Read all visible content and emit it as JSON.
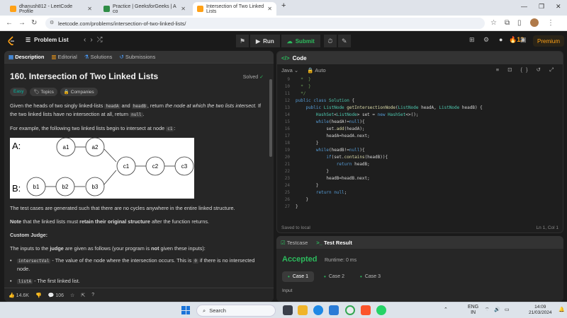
{
  "browser": {
    "tabs": [
      {
        "title": "dhanush812 - LeetCode Profile",
        "color": "#ffa116",
        "active": false
      },
      {
        "title": "Practice | GeeksforGeeks | A co",
        "color": "#2f8d46",
        "active": false
      },
      {
        "title": "Intersection of Two Linked Lists",
        "color": "#ffa116",
        "active": true
      }
    ],
    "url": "leetcode.com/problems/intersection-of-two-linked-lists/"
  },
  "nav": {
    "problem_list": "Problem List",
    "run": "Run",
    "submit": "Submit",
    "streak": "13",
    "premium": "Premium"
  },
  "left": {
    "tabs": [
      "Description",
      "Editorial",
      "Solutions",
      "Submissions"
    ],
    "title": "160. Intersection of Two Linked Lists",
    "solved": "Solved",
    "tags": [
      "Easy",
      "Topics",
      "Companies"
    ],
    "desc_1": "Given the heads of two singly linked-lists",
    "headA": "headA",
    "and": "and",
    "headB": "headB",
    "desc_2": ", return",
    "desc_3": "the node at which the two lists intersect.",
    "desc_4": "If the two linked lists have no intersection at all, return",
    "null": "null",
    "example_intro": "For example, the following two linked lists begin to intersect at node",
    "c1": "c1",
    "diagram": {
      "labelA": "A:",
      "labelB": "B:",
      "nodes": [
        "a1",
        "a2",
        "c1",
        "c2",
        "c3",
        "b1",
        "b2",
        "b3"
      ]
    },
    "p_cycles": "The test cases are generated such that there are no cycles anywhere in the entire linked structure.",
    "note_label": "Note",
    "note_mid": "that the linked lists must",
    "note_bold": "retain their original structure",
    "note_end": "after the function returns.",
    "judge_heading": "Custom Judge:",
    "judge_intro_1": "The inputs to the",
    "judge_word": "judge",
    "judge_intro_2": "are given as follows (your program is",
    "not_word": "not",
    "judge_intro_3": "given these inputs):",
    "b1_code": "intersectVal",
    "b1_text": "- The value of the node where the intersection occurs. This is",
    "b1_zero": "0",
    "b1_end": "if there is no intersected node.",
    "b2_code": "listA",
    "b2_text": "- The first linked list.",
    "likes": "14.6K",
    "comments": "106"
  },
  "code": {
    "header": "Code",
    "lang": "Java",
    "auto": "Auto",
    "lines": [
      {
        "n": "9",
        "t": "  *  }"
      },
      {
        "n": "10",
        "t": "  *  }"
      },
      {
        "n": "11",
        "t": "  */"
      },
      {
        "n": "12",
        "t": "public class Solution {"
      },
      {
        "n": "13",
        "t": "    public ListNode getIntersectionNode(ListNode headA, ListNode headB) {"
      },
      {
        "n": "14",
        "t": "        HashSet<ListNode> set = new HashSet<>();"
      },
      {
        "n": "15",
        "t": "        while(headA!=null){"
      },
      {
        "n": "16",
        "t": "            set.add(headA);"
      },
      {
        "n": "17",
        "t": "            headA=headA.next;"
      },
      {
        "n": "18",
        "t": "        }"
      },
      {
        "n": "19",
        "t": "        while(headB!=null){"
      },
      {
        "n": "20",
        "t": "            if(set.contains(headB)){"
      },
      {
        "n": "21",
        "t": "                return headB;"
      },
      {
        "n": "22",
        "t": "            }"
      },
      {
        "n": "23",
        "t": "            headB=headB.next;"
      },
      {
        "n": "24",
        "t": "        }"
      },
      {
        "n": "25",
        "t": "        return null;"
      },
      {
        "n": "26",
        "t": "    }"
      },
      {
        "n": "27",
        "t": "}"
      }
    ],
    "saved": "Saved to local",
    "position": "Ln 1, Col 1"
  },
  "result": {
    "tabs": [
      "Testcase",
      "Test Result"
    ],
    "status": "Accepted",
    "runtime": "Runtime: 0 ms",
    "cases": [
      "Case 1",
      "Case 2",
      "Case 3"
    ],
    "input_label": "Input"
  },
  "taskbar": {
    "search": "Search",
    "lang_top": "ENG",
    "lang_bottom": "IN",
    "time": "14:09",
    "date": "21/03/2024"
  }
}
